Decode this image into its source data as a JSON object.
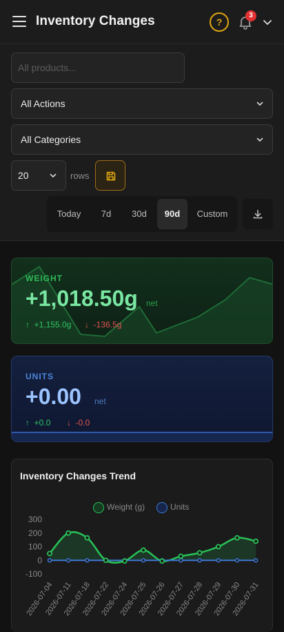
{
  "header": {
    "title": "Inventory Changes",
    "help_icon": "?",
    "notification_count": "3"
  },
  "filters": {
    "search_placeholder": "All products...",
    "actions_value": "All Actions",
    "categories_value": "All Categories",
    "rows_value": "20",
    "rows_label": "rows",
    "ranges": [
      "Today",
      "7d",
      "30d",
      "90d",
      "Custom"
    ],
    "active_range": "90d"
  },
  "stats": {
    "weight": {
      "label": "WEIGHT",
      "value": "+1,018.50g",
      "unit": "net",
      "up": "+1,155.0g",
      "down": "-136.5g"
    },
    "units": {
      "label": "UNITS",
      "value": "+0.00",
      "unit": "net",
      "up": "+0.0",
      "down": "-0.0"
    }
  },
  "colors": {
    "accent_amber": "#e2a812",
    "weight_green": "#28c258",
    "units_blue": "#3e78d6",
    "badge_red": "#e33131",
    "down_red": "#e35353"
  },
  "chart_data": {
    "type": "line",
    "title": "Inventory Changes Trend",
    "legend_position": "top",
    "categories": [
      "2026-07-04",
      "2026-07-11",
      "2026-07-18",
      "2026-07-22",
      "2026-07-24",
      "2026-07-25",
      "2026-07-26",
      "2026-07-27",
      "2026-07-28",
      "2026-07-29",
      "2026-07-30",
      "2026-07-31"
    ],
    "series": [
      {
        "name": "Weight (g)",
        "color": "#28c258",
        "values": [
          50,
          200,
          165,
          0,
          -5,
          75,
          -5,
          30,
          55,
          100,
          165,
          140
        ]
      },
      {
        "name": "Units",
        "color": "#3e78d6",
        "values": [
          0,
          0,
          0,
          0,
          0,
          0,
          0,
          0,
          0,
          0,
          0,
          0
        ]
      }
    ],
    "y_ticks": [
      "300",
      "200",
      "100",
      "0",
      "-100"
    ],
    "ylim": [
      -100,
      300
    ],
    "grid": false
  }
}
